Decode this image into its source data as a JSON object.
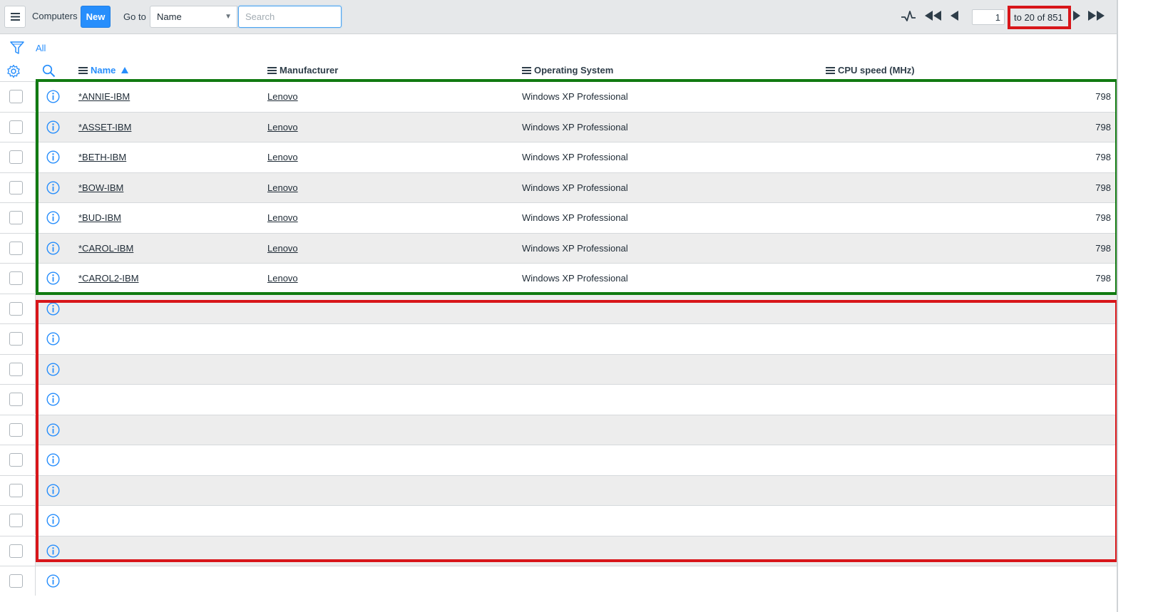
{
  "header": {
    "title": "Computers",
    "new_label": "New",
    "goto_label": "Go to",
    "goto_field": "Name",
    "search_placeholder": "Search",
    "page_number": "1",
    "page_range": "to 20 of 851"
  },
  "filter": {
    "label": "All"
  },
  "columns": {
    "name": "Name",
    "manufacturer": "Manufacturer",
    "os": "Operating System",
    "cpu": "CPU speed (MHz)"
  },
  "rows": [
    {
      "name": "*ANNIE-IBM",
      "manufacturer": "Lenovo",
      "os": "Windows XP Professional",
      "cpu": "798"
    },
    {
      "name": "*ASSET-IBM",
      "manufacturer": "Lenovo",
      "os": "Windows XP Professional",
      "cpu": "798"
    },
    {
      "name": "*BETH-IBM",
      "manufacturer": "Lenovo",
      "os": "Windows XP Professional",
      "cpu": "798"
    },
    {
      "name": "*BOW-IBM",
      "manufacturer": "Lenovo",
      "os": "Windows XP Professional",
      "cpu": "798"
    },
    {
      "name": "*BUD-IBM",
      "manufacturer": "Lenovo",
      "os": "Windows XP Professional",
      "cpu": "798"
    },
    {
      "name": "*CAROL-IBM",
      "manufacturer": "Lenovo",
      "os": "Windows XP Professional",
      "cpu": "798"
    },
    {
      "name": "*CAROL2-IBM",
      "manufacturer": "Lenovo",
      "os": "Windows XP Professional",
      "cpu": "798"
    },
    {
      "name": "",
      "manufacturer": "",
      "os": "",
      "cpu": ""
    },
    {
      "name": "",
      "manufacturer": "",
      "os": "",
      "cpu": ""
    },
    {
      "name": "",
      "manufacturer": "",
      "os": "",
      "cpu": ""
    },
    {
      "name": "",
      "manufacturer": "",
      "os": "",
      "cpu": ""
    },
    {
      "name": "",
      "manufacturer": "",
      "os": "",
      "cpu": ""
    },
    {
      "name": "",
      "manufacturer": "",
      "os": "",
      "cpu": ""
    },
    {
      "name": "",
      "manufacturer": "",
      "os": "",
      "cpu": ""
    },
    {
      "name": "",
      "manufacturer": "",
      "os": "",
      "cpu": ""
    },
    {
      "name": "",
      "manufacturer": "",
      "os": "",
      "cpu": ""
    },
    {
      "name": "",
      "manufacturer": "",
      "os": "",
      "cpu": ""
    }
  ],
  "colors": {
    "accent": "#278efc",
    "highlight_green": "#117a11",
    "highlight_red": "#d8161a"
  },
  "annotations": [
    {
      "type": "box",
      "color": "green",
      "target": "populated rows"
    },
    {
      "type": "box",
      "color": "red",
      "target": "empty rows"
    },
    {
      "type": "box",
      "color": "red",
      "target": "page range"
    }
  ]
}
